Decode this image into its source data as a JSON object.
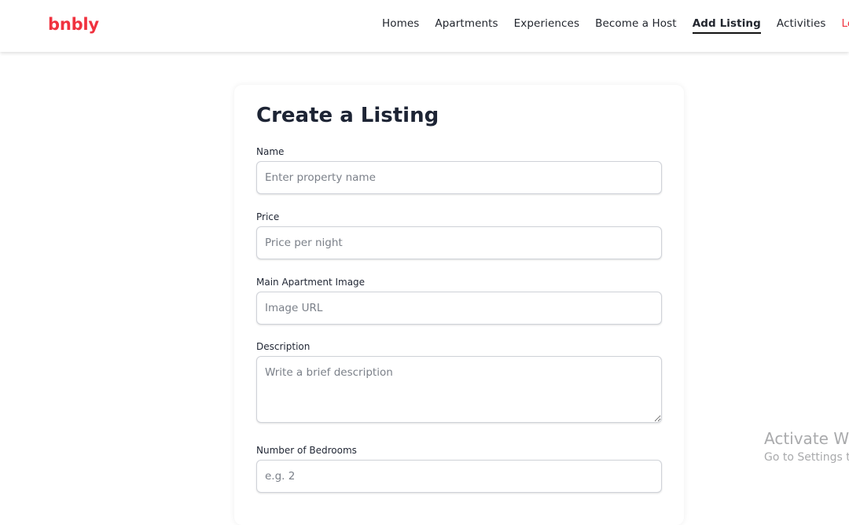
{
  "brand": {
    "logo": "bnbly",
    "accent": "#f0323f"
  },
  "nav": {
    "homes": "Homes",
    "apartments": "Apartments",
    "experiences": "Experiences",
    "become_host": "Become a Host",
    "add_listing": "Add Listing",
    "activities": "Activities",
    "logout": "Log"
  },
  "form": {
    "title": "Create a Listing",
    "name": {
      "label": "Name",
      "placeholder": "Enter property name",
      "value": ""
    },
    "price": {
      "label": "Price",
      "placeholder": "Price per night",
      "value": ""
    },
    "image": {
      "label": "Main Apartment Image",
      "placeholder": "Image URL",
      "value": ""
    },
    "description": {
      "label": "Description",
      "placeholder": "Write a brief description",
      "value": ""
    },
    "bedrooms": {
      "label": "Number of Bedrooms",
      "placeholder": "e.g. 2",
      "value": ""
    }
  },
  "watermark": {
    "title": "Activate Wi",
    "subtitle": "Go to Settings t"
  }
}
